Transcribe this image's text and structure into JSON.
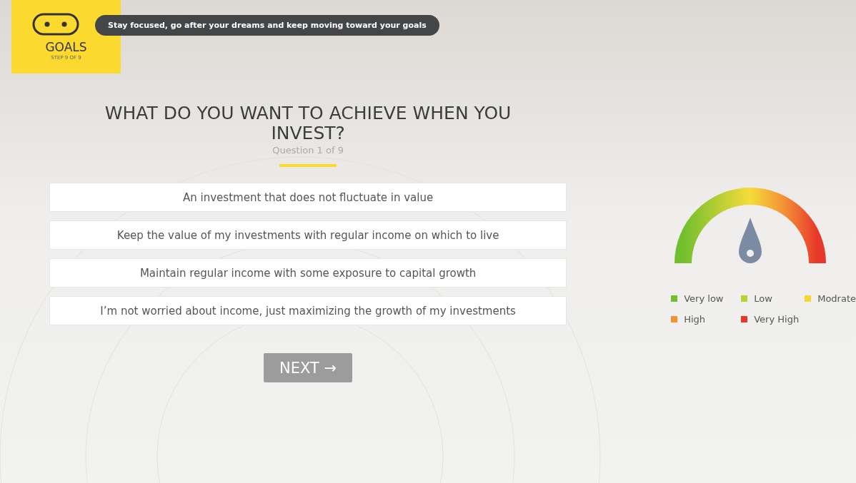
{
  "header": {
    "step_title": "GOALS",
    "step_count": "STEP 9 OF 9",
    "tip": "Stay focused, go after your dreams and keep moving toward your goals"
  },
  "question": {
    "title": "WHAT DO YOU WANT TO ACHIEVE WHEN YOU INVEST?",
    "counter": "Question 1 of 9"
  },
  "answers": [
    {
      "label": "An investment that does not fluctuate in value"
    },
    {
      "label": "Keep the value of my investments with regular income on which to live"
    },
    {
      "label": "Maintain regular income with some exposure to capital growth"
    },
    {
      "label": "I’m not worried about income, just maximizing the growth of my investments"
    }
  ],
  "next_button": "NEXT →",
  "legend": [
    {
      "label": "Very low",
      "color": "#72bf2e"
    },
    {
      "label": "Low",
      "color": "#b5d334"
    },
    {
      "label": "Modrate",
      "color": "#f5d633"
    },
    {
      "label": "High",
      "color": "#f39135"
    },
    {
      "label": "Very High",
      "color": "#e8382b"
    }
  ]
}
